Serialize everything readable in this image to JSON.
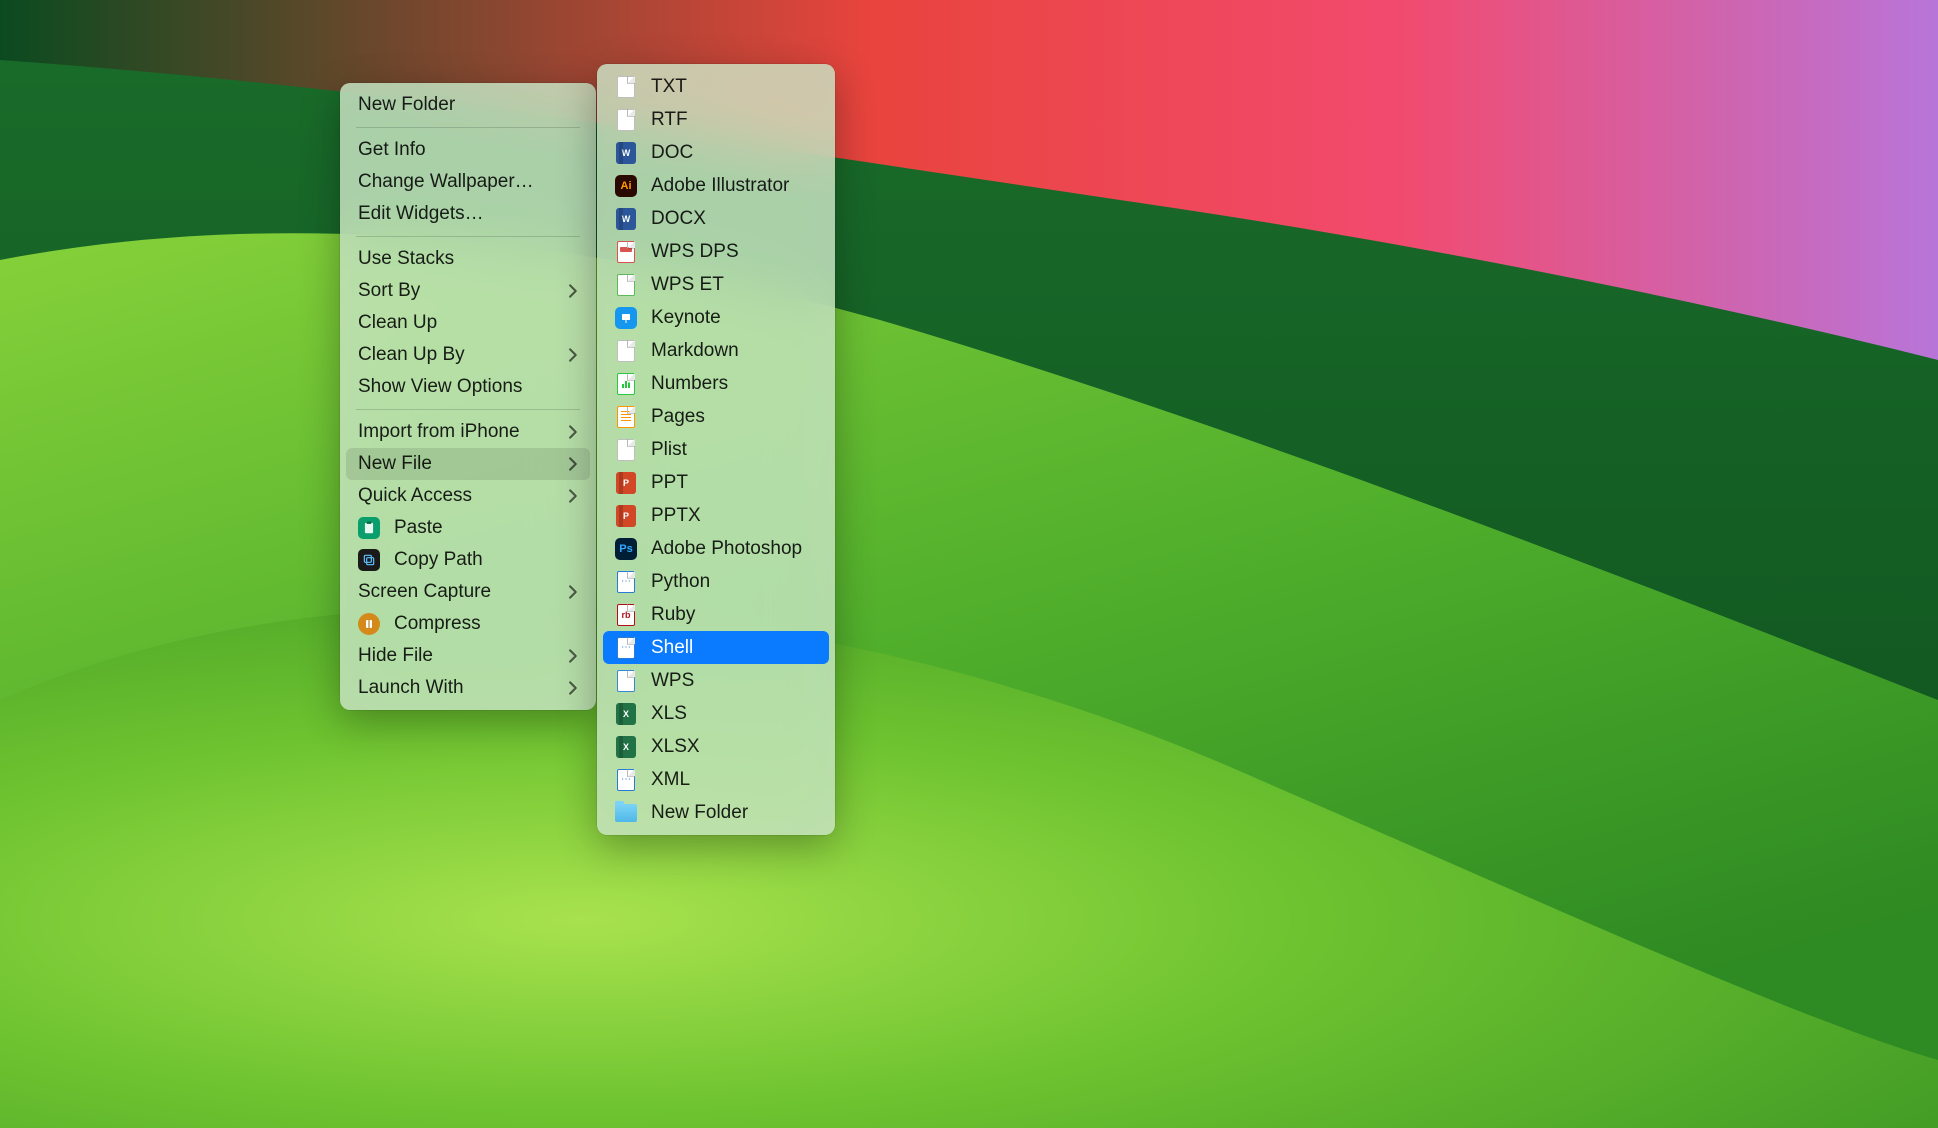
{
  "primary_menu": {
    "groups": [
      [
        {
          "key": "new-folder",
          "label": "New Folder",
          "submenu": false,
          "icon": null
        }
      ],
      [
        {
          "key": "get-info",
          "label": "Get Info",
          "submenu": false,
          "icon": null
        },
        {
          "key": "change-wallpaper",
          "label": "Change Wallpaper…",
          "submenu": false,
          "icon": null
        },
        {
          "key": "edit-widgets",
          "label": "Edit Widgets…",
          "submenu": false,
          "icon": null
        }
      ],
      [
        {
          "key": "use-stacks",
          "label": "Use Stacks",
          "submenu": false,
          "icon": null
        },
        {
          "key": "sort-by",
          "label": "Sort By",
          "submenu": true,
          "icon": null
        },
        {
          "key": "clean-up",
          "label": "Clean Up",
          "submenu": false,
          "icon": null
        },
        {
          "key": "clean-up-by",
          "label": "Clean Up By",
          "submenu": true,
          "icon": null
        },
        {
          "key": "show-view-options",
          "label": "Show View Options",
          "submenu": false,
          "icon": null
        }
      ],
      [
        {
          "key": "import-from-iphone",
          "label": "Import from iPhone",
          "submenu": true,
          "icon": null
        },
        {
          "key": "new-file",
          "label": "New File",
          "submenu": true,
          "icon": null,
          "hover": true
        },
        {
          "key": "quick-access",
          "label": "Quick Access",
          "submenu": true,
          "icon": null
        },
        {
          "key": "paste",
          "label": "Paste",
          "submenu": false,
          "icon": "paste"
        },
        {
          "key": "copy-path",
          "label": "Copy Path",
          "submenu": false,
          "icon": "copy-path"
        },
        {
          "key": "screen-capture",
          "label": "Screen Capture",
          "submenu": true,
          "icon": null
        },
        {
          "key": "compress",
          "label": "Compress",
          "submenu": false,
          "icon": "compress"
        },
        {
          "key": "hide-file",
          "label": "Hide File",
          "submenu": true,
          "icon": null
        },
        {
          "key": "launch-with",
          "label": "Launch With",
          "submenu": true,
          "icon": null
        }
      ]
    ]
  },
  "submenu": {
    "items": [
      {
        "key": "txt",
        "label": "TXT",
        "icon": "file-generic"
      },
      {
        "key": "rtf",
        "label": "RTF",
        "icon": "file-generic"
      },
      {
        "key": "doc",
        "label": "DOC",
        "icon": "word"
      },
      {
        "key": "ai",
        "label": "Adobe Illustrator",
        "icon": "illustrator"
      },
      {
        "key": "docx",
        "label": "DOCX",
        "icon": "word"
      },
      {
        "key": "wps-dps",
        "label": "WPS DPS",
        "icon": "file-dps"
      },
      {
        "key": "wps-et",
        "label": "WPS ET",
        "icon": "file-et"
      },
      {
        "key": "keynote",
        "label": "Keynote",
        "icon": "keynote"
      },
      {
        "key": "markdown",
        "label": "Markdown",
        "icon": "file-generic"
      },
      {
        "key": "numbers",
        "label": "Numbers",
        "icon": "numbers"
      },
      {
        "key": "pages",
        "label": "Pages",
        "icon": "pages"
      },
      {
        "key": "plist",
        "label": "Plist",
        "icon": "file-generic"
      },
      {
        "key": "ppt",
        "label": "PPT",
        "icon": "powerpoint"
      },
      {
        "key": "pptx",
        "label": "PPTX",
        "icon": "powerpoint"
      },
      {
        "key": "psd",
        "label": "Adobe Photoshop",
        "icon": "photoshop"
      },
      {
        "key": "python",
        "label": "Python",
        "icon": "file-code-blue"
      },
      {
        "key": "ruby",
        "label": "Ruby",
        "icon": "file-ruby"
      },
      {
        "key": "shell",
        "label": "Shell",
        "icon": "file-code-blue",
        "selected": true
      },
      {
        "key": "wps",
        "label": "WPS",
        "icon": "file-wps"
      },
      {
        "key": "xls",
        "label": "XLS",
        "icon": "excel"
      },
      {
        "key": "xlsx",
        "label": "XLSX",
        "icon": "excel"
      },
      {
        "key": "xml",
        "label": "XML",
        "icon": "file-code-blue"
      },
      {
        "key": "new-folder",
        "label": "New Folder",
        "icon": "folder"
      }
    ]
  },
  "icon_colors": {
    "word": "#2b579a",
    "excel": "#217346",
    "powerpoint": "#d24726",
    "illustrator_bg": "#2a0a00",
    "illustrator_fg": "#ff9a00",
    "photoshop_bg": "#001e36",
    "photoshop_fg": "#31a8ff",
    "keynote": "#1597f0",
    "numbers": "#28c941",
    "pages": "#ff9500",
    "ruby_border": "#b11116",
    "selection": "#0a7bff"
  }
}
